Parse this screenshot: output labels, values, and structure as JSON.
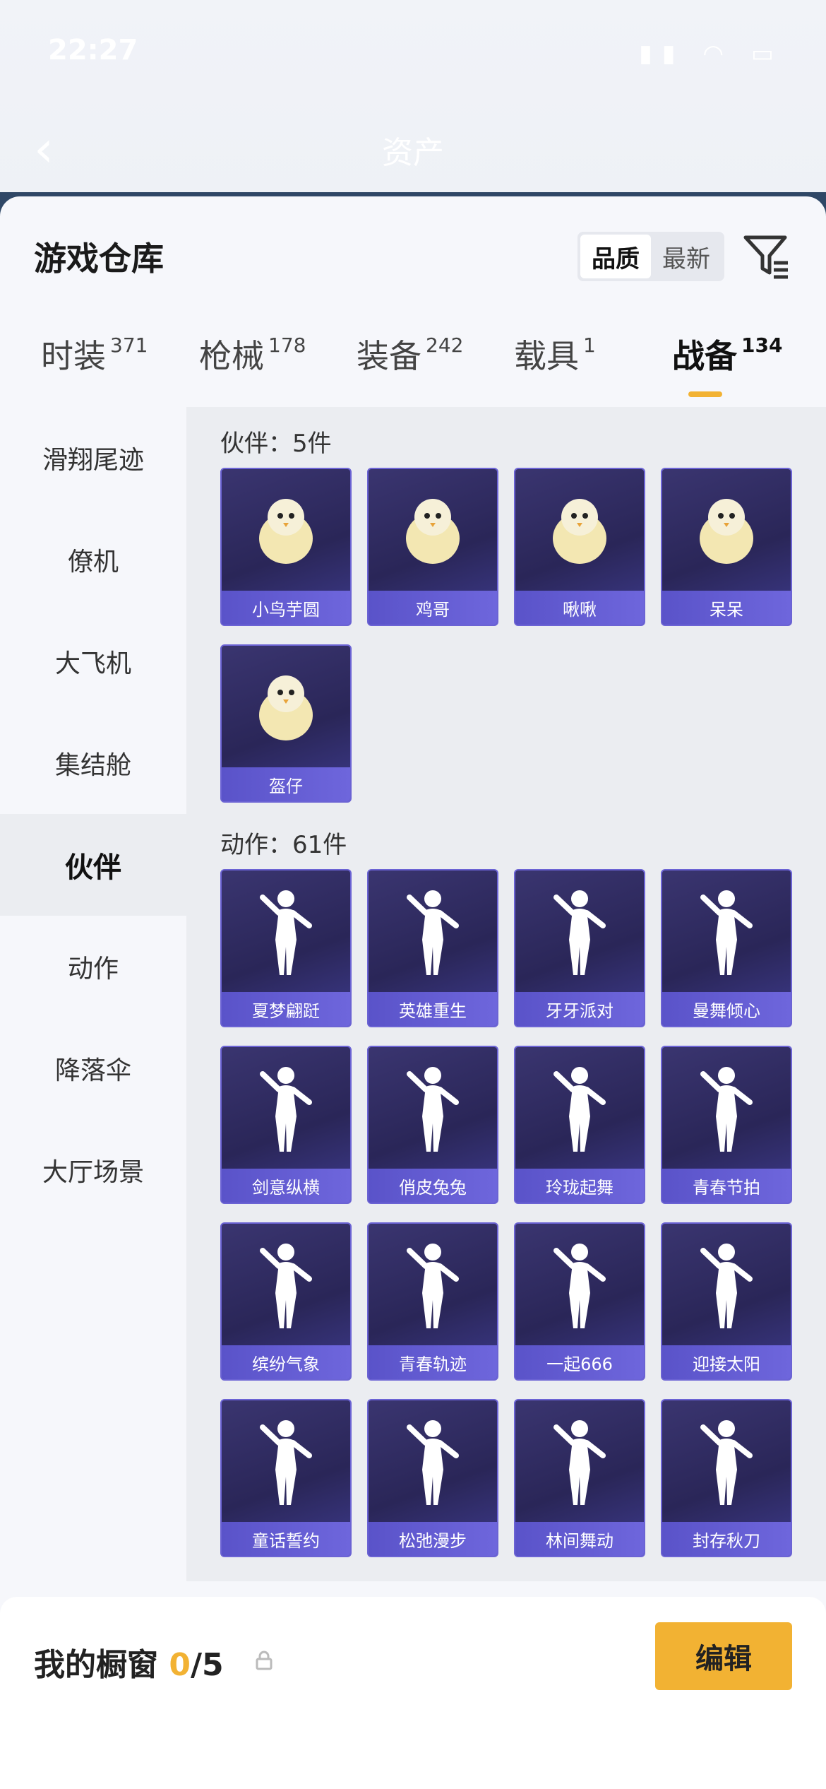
{
  "status_bar": {
    "time": "22:27",
    "page_title": "资产"
  },
  "sheet": {
    "title": "游戏仓库"
  },
  "sort": {
    "options": [
      "品质",
      "最新"
    ],
    "active": 0
  },
  "tabs": [
    {
      "label": "时装",
      "count": "371"
    },
    {
      "label": "枪械",
      "count": "178"
    },
    {
      "label": "装备",
      "count": "242"
    },
    {
      "label": "载具",
      "count": "1"
    },
    {
      "label": "战备",
      "count": "134"
    }
  ],
  "sidebar": {
    "items": [
      {
        "label": "滑翔尾迹"
      },
      {
        "label": "僚机"
      },
      {
        "label": "大飞机"
      },
      {
        "label": "集结舱"
      },
      {
        "label": "伙伴"
      },
      {
        "label": "动作"
      },
      {
        "label": "降落伞"
      },
      {
        "label": "大厅场景"
      }
    ],
    "active": 4
  },
  "sections": {
    "partners": {
      "title": "伙伴：5件",
      "items": [
        "小鸟芋圆",
        "鸡哥",
        "啾啾",
        "呆呆",
        "盔仔"
      ]
    },
    "actions": {
      "title": "动作：61件",
      "items": [
        "夏梦翩跹",
        "英雄重生",
        "牙牙派对",
        "曼舞倾心",
        "剑意纵横",
        "俏皮兔兔",
        "玲珑起舞",
        "青春节拍",
        "缤纷气象",
        "青春轨迹",
        "一起666",
        "迎接太阳",
        "童话誓约",
        "松弛漫步",
        "林间舞动",
        "封存秋刀"
      ]
    }
  },
  "footer": {
    "label": "我的橱窗",
    "current": "0",
    "total": "/5",
    "edit_label": "编辑"
  },
  "colors": {
    "accent": "#f2b233",
    "card": "#2a2658",
    "label": "#6e66dc"
  }
}
